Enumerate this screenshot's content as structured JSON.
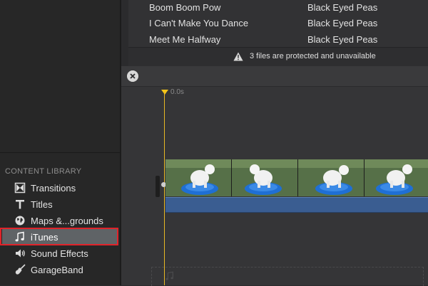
{
  "songs": [
    {
      "title": "Boom Boom Pow",
      "artist": "Black Eyed Peas"
    },
    {
      "title": "I Can't Make You Dance",
      "artist": "Black Eyed Peas"
    },
    {
      "title": "Meet Me Halfway",
      "artist": "Black Eyed Peas"
    }
  ],
  "protected_notice": "3 files are protected and unavailable",
  "timeline": {
    "playhead_time": "0.0s"
  },
  "content_library": {
    "header": "CONTENT LIBRARY",
    "items": [
      {
        "label": "Transitions",
        "icon": "transitions-icon"
      },
      {
        "label": "Titles",
        "icon": "titles-icon"
      },
      {
        "label": "Maps &...grounds",
        "icon": "globe-icon"
      },
      {
        "label": "iTunes",
        "icon": "music-note-icon",
        "selected": true
      },
      {
        "label": "Sound Effects",
        "icon": "speaker-icon"
      },
      {
        "label": "GarageBand",
        "icon": "guitar-icon"
      }
    ]
  },
  "colors": {
    "selection_outline": "#e0232a",
    "playhead": "#f5c518",
    "audio_track": "#3a5d91"
  }
}
